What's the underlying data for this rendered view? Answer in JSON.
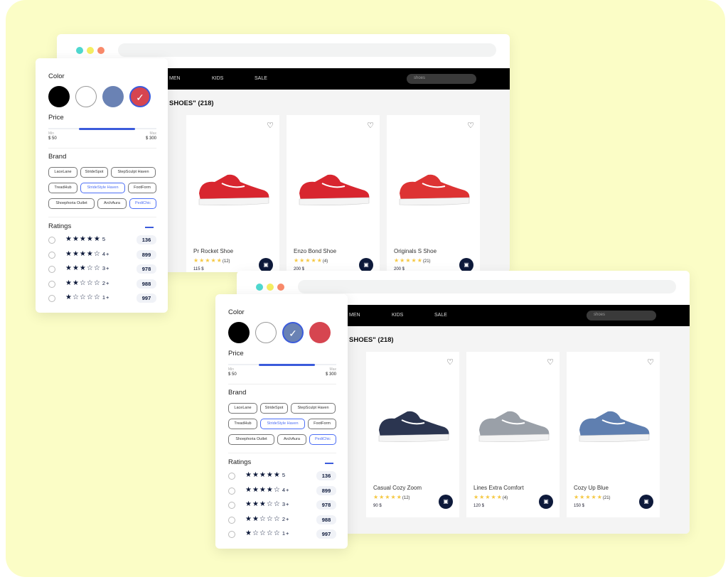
{
  "colors": {
    "background": "#fbfdc6",
    "accent": "#3b5bdb",
    "navy": "#0e1a3b",
    "star": "#f5c842"
  },
  "window_dots": [
    "#4fd8cf",
    "#f4ee62",
    "#f98a6a"
  ],
  "scenes": [
    {
      "nav": [
        "MEN",
        "KIDS",
        "SALE"
      ],
      "search": "shoes",
      "results_title": "SHOES\" (218)",
      "products": [
        {
          "name": "Pr Rocket Shoe",
          "stars": "★★★★★",
          "reviews": "(12)",
          "price": "115 $",
          "color": "#d8262f"
        },
        {
          "name": "Enzo Bond Shoe",
          "stars": "★★★★★",
          "reviews": "(4)",
          "price": "200 $",
          "color": "#d8262f"
        },
        {
          "name": "Originals S Shoe",
          "stars": "★★★★★",
          "reviews": "(21)",
          "price": "200 $",
          "color": "#d33"
        }
      ],
      "selected_color": 3
    },
    {
      "nav": [
        "MEN",
        "KIDS",
        "SALE"
      ],
      "search": "shoes",
      "results_title": "SHOES\" (218)",
      "products": [
        {
          "name": "Casual Cozy Zoom",
          "stars": "★★★★★",
          "reviews": "(12)",
          "price": "90 $",
          "color": "#2b3550"
        },
        {
          "name": "Lines Extra Comfort",
          "stars": "★★★★★",
          "reviews": "(4)",
          "price": "120 $",
          "color": "#9aa0a8"
        },
        {
          "name": "Cozy Up Blue",
          "stars": "★★★★★",
          "reviews": "(21)",
          "price": "150 $",
          "color": "#5f7fb0"
        }
      ],
      "selected_color": 2
    }
  ],
  "filters": {
    "color_label": "Color",
    "swatches": [
      "#000000",
      "#ffffff",
      "#6a82b4",
      "#d64550"
    ],
    "price_label": "Price",
    "price_range_fraction": [
      0.28,
      0.8
    ],
    "min_label": "Min",
    "max_label": "Max",
    "min_value": "$ 50",
    "max_value": "$ 300",
    "brand_label": "Brand",
    "brands": [
      [
        {
          "name": "LaceLane"
        },
        {
          "name": "StrideSpot"
        },
        {
          "name": "StepSculpt Haven"
        }
      ],
      [
        {
          "name": "TreadHub"
        },
        {
          "name": "StrideStyle Haven",
          "selected": true
        },
        {
          "name": "FootForm"
        }
      ],
      [
        {
          "name": "Shoephoria Outlet"
        },
        {
          "name": "ArchAura"
        },
        {
          "name": "PediChic",
          "selected": true
        }
      ]
    ],
    "ratings_label": "Ratings",
    "ratings": [
      {
        "stars": "★★★★★",
        "label": "5",
        "count": "136"
      },
      {
        "stars": "★★★★☆",
        "label": "4+",
        "count": "899"
      },
      {
        "stars": "★★★☆☆",
        "label": "3+",
        "count": "978"
      },
      {
        "stars": "★★☆☆☆",
        "label": "2+",
        "count": "988"
      },
      {
        "stars": "★☆☆☆☆",
        "label": "1+",
        "count": "997"
      }
    ]
  }
}
